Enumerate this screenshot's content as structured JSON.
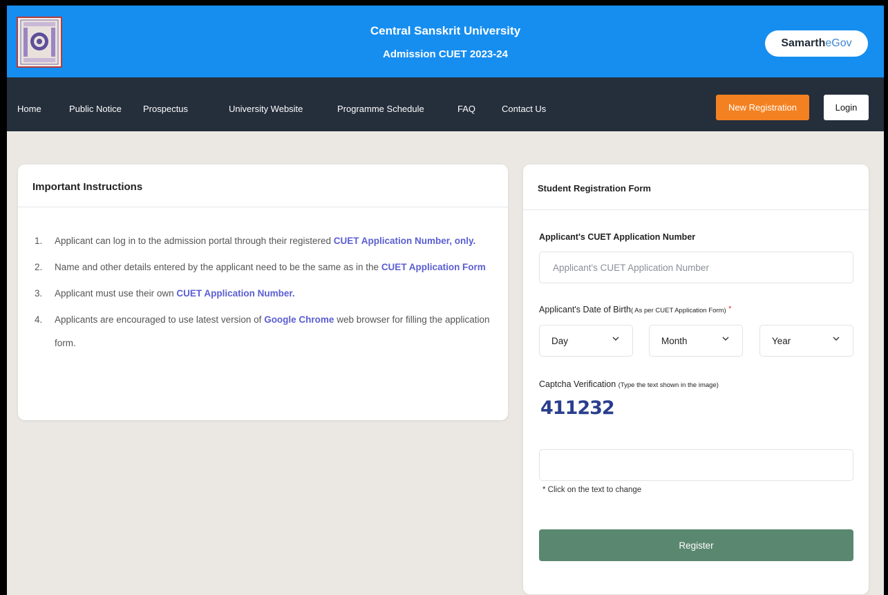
{
  "header": {
    "university_name": "Central Sanskrit University",
    "admission_title": "Admission CUET 2023-24",
    "brand_part1": "Samarth",
    "brand_part2": "eGov"
  },
  "nav": {
    "items": [
      {
        "label": "Home"
      },
      {
        "label": "Public Notice"
      },
      {
        "label": "Prospectus"
      },
      {
        "label": "University Website"
      },
      {
        "label": "Programme Schedule"
      },
      {
        "label": "FAQ"
      },
      {
        "label": "Contact Us"
      }
    ],
    "new_registration": "New Registration",
    "login": "Login"
  },
  "instructions": {
    "title": "Important Instructions",
    "items": [
      {
        "num": "1.",
        "pre": "Applicant can log in to the admission portal through their registered ",
        "hl": "CUET Application Number, only.",
        "post": ""
      },
      {
        "num": "2.",
        "pre": "Name and other details entered by the applicant need to be the same as in the ",
        "hl": "CUET Application Form",
        "post": ""
      },
      {
        "num": "3.",
        "pre": "Applicant must use their own ",
        "hl": "CUET Application Number.",
        "post": ""
      },
      {
        "num": "4.",
        "pre": "Applicants are encouraged to use latest version of ",
        "hl": "Google Chrome",
        "post": " web browser for filling the application form."
      }
    ]
  },
  "form": {
    "title": "Student Registration Form",
    "app_number_label": "Applicant's CUET Application Number",
    "app_number_placeholder": "Applicant's CUET Application Number",
    "dob_label": "Applicant's Date of Birth",
    "dob_note": "( As per CUET Application Form)",
    "required_mark": "*",
    "day": "Day",
    "month": "Month",
    "year": "Year",
    "captcha_label": "Captcha Verification",
    "captcha_note": "(Type the text shown in the image)",
    "captcha_text": "411232",
    "captcha_hint": "* Click on the text to change",
    "register": "Register"
  },
  "colors": {
    "banner": "#168ef0",
    "nav": "#252e3b",
    "new_registration": "#f48121",
    "register": "#5a8770",
    "highlight": "#5a5ed0"
  }
}
